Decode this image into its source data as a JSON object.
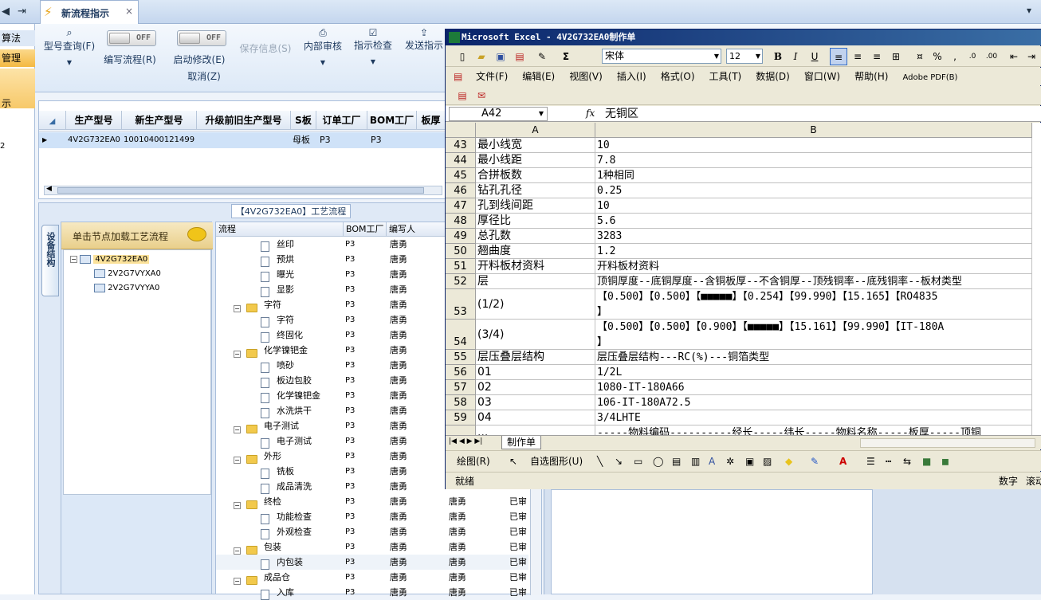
{
  "top": {
    "tab_label": "新流程指示"
  },
  "left_strip": {
    "items": [
      "算法",
      "管理",
      "示",
      "2"
    ]
  },
  "toolbar": {
    "model_query": "型号查询(F)",
    "write_flow": "编写流程(R)",
    "start_modify": "启动修改(E)",
    "cancel": "取消(Z)",
    "save_info": "保存信息(S)",
    "internal_review": "内部审核",
    "instruction_check": "指示检查",
    "send_instruction": "发送指示",
    "toggle_off": "OFF"
  },
  "grid": {
    "columns": [
      "生产型号",
      "新生产型号",
      "升级前旧生产型号",
      "S板",
      "订单工厂",
      "BOM工厂",
      "板厚"
    ],
    "rows": [
      [
        "4V2G732EA0",
        "10010400121499",
        "",
        "母板",
        "P3",
        "P3",
        ""
      ]
    ]
  },
  "process": {
    "title": "【4V2G732EA0】工艺流程",
    "side_tab": "设备结构",
    "tree_hint": "单击节点加载工艺流程",
    "tree_nodes": [
      "4V2G732EA0",
      "2V2G7VYXA0",
      "2V2G7VYYA0"
    ],
    "columns": [
      "流程",
      "BOM工厂",
      "编写人"
    ],
    "rows": [
      {
        "name": "丝印",
        "level": 2,
        "bom": "P3",
        "writer": "唐勇",
        "extra": "",
        "status": ""
      },
      {
        "name": "预烘",
        "level": 2,
        "bom": "P3",
        "writer": "唐勇",
        "extra": "",
        "status": ""
      },
      {
        "name": "曝光",
        "level": 2,
        "bom": "P3",
        "writer": "唐勇",
        "extra": "",
        "status": ""
      },
      {
        "name": "显影",
        "level": 2,
        "bom": "P3",
        "writer": "唐勇",
        "extra": "",
        "status": ""
      },
      {
        "name": "字符",
        "level": 1,
        "bom": "P3",
        "writer": "唐勇",
        "extra": "",
        "status": ""
      },
      {
        "name": "字符",
        "level": 2,
        "bom": "P3",
        "writer": "唐勇",
        "extra": "",
        "status": ""
      },
      {
        "name": "终固化",
        "level": 2,
        "bom": "P3",
        "writer": "唐勇",
        "extra": "",
        "status": ""
      },
      {
        "name": "化学镍钯金",
        "level": 1,
        "bom": "P3",
        "writer": "唐勇",
        "extra": "",
        "status": ""
      },
      {
        "name": "喷砂",
        "level": 2,
        "bom": "P3",
        "writer": "唐勇",
        "extra": "",
        "status": ""
      },
      {
        "name": "板边包胶",
        "level": 2,
        "bom": "P3",
        "writer": "唐勇",
        "extra": "",
        "status": ""
      },
      {
        "name": "化学镍钯金",
        "level": 2,
        "bom": "P3",
        "writer": "唐勇",
        "extra": "",
        "status": ""
      },
      {
        "name": "水洗烘干",
        "level": 2,
        "bom": "P3",
        "writer": "唐勇",
        "extra": "",
        "status": ""
      },
      {
        "name": "电子测试",
        "level": 1,
        "bom": "P3",
        "writer": "唐勇",
        "extra": "",
        "status": ""
      },
      {
        "name": "电子测试",
        "level": 2,
        "bom": "P3",
        "writer": "唐勇",
        "extra": "",
        "status": ""
      },
      {
        "name": "外形",
        "level": 1,
        "bom": "P3",
        "writer": "唐勇",
        "extra": "",
        "status": ""
      },
      {
        "name": "铣板",
        "level": 2,
        "bom": "P3",
        "writer": "唐勇",
        "extra": "",
        "status": ""
      },
      {
        "name": "成品清洗",
        "level": 2,
        "bom": "P3",
        "writer": "唐勇",
        "extra": "",
        "status": ""
      },
      {
        "name": "终检",
        "level": 1,
        "bom": "P3",
        "writer": "唐勇",
        "extra": "唐勇",
        "status": "已审"
      },
      {
        "name": "功能检查",
        "level": 2,
        "bom": "P3",
        "writer": "唐勇",
        "extra": "唐勇",
        "status": "已审"
      },
      {
        "name": "外观检查",
        "level": 2,
        "bom": "P3",
        "writer": "唐勇",
        "extra": "唐勇",
        "status": "已审"
      },
      {
        "name": "包装",
        "level": 1,
        "bom": "P3",
        "writer": "唐勇",
        "extra": "唐勇",
        "status": "已审"
      },
      {
        "name": "内包装",
        "level": 2,
        "bom": "P3",
        "writer": "唐勇",
        "extra": "唐勇",
        "status": "已审"
      },
      {
        "name": "成品仓",
        "level": 1,
        "bom": "P3",
        "writer": "唐勇",
        "extra": "唐勇",
        "status": "已审"
      },
      {
        "name": "入库",
        "level": 2,
        "bom": "P3",
        "writer": "唐勇",
        "extra": "唐勇",
        "status": "已审"
      }
    ]
  },
  "excel": {
    "title": "Microsoft Excel - 4V2G732EA0制作单",
    "font": "宋体",
    "font_size": "12",
    "menu": [
      "文件(F)",
      "编辑(E)",
      "视图(V)",
      "插入(I)",
      "格式(O)",
      "工具(T)",
      "数据(D)",
      "窗口(W)",
      "帮助(H)",
      "Adobe PDF(B)"
    ],
    "name_box": "A42",
    "formula": "无铜区",
    "col_a": "A",
    "col_b": "B",
    "rows": [
      {
        "n": "43",
        "a": "最小线宽",
        "b": "10"
      },
      {
        "n": "44",
        "a": "最小线距",
        "b": "7.8"
      },
      {
        "n": "45",
        "a": "合拼板数",
        "b": "1种相同"
      },
      {
        "n": "46",
        "a": "钻孔孔径",
        "b": "0.25"
      },
      {
        "n": "47",
        "a": "孔到线间距",
        "b": "10"
      },
      {
        "n": "48",
        "a": "厚径比",
        "b": "5.6"
      },
      {
        "n": "49",
        "a": "总孔数",
        "b": "3283"
      },
      {
        "n": "50",
        "a": "翘曲度",
        "b": "1.2"
      },
      {
        "n": "51",
        "a": "开料板材资料",
        "b": "开料板材资料"
      },
      {
        "n": "52",
        "a": "层",
        "b": "顶铜厚度--底铜厚度--含铜板厚--不含铜厚--顶残铜率--底残铜率--板材类型"
      },
      {
        "n": "53",
        "a": "(1/2)",
        "b": "【0.500】【0.500】【■■■■■】【0.254】【99.990】【15.165】【RO4835",
        "b2": "】"
      },
      {
        "n": "54",
        "a": "(3/4)",
        "b": "【0.500】【0.500】【0.900】【■■■■■】【15.161】【99.990】【IT-180A",
        "b2": "】"
      },
      {
        "n": "55",
        "a": "层压叠层结构",
        "b": "层压叠层结构---RC(%)---铜箔类型"
      },
      {
        "n": "56",
        "a": "01",
        "b": "1/2L"
      },
      {
        "n": "57",
        "a": "02",
        "b": "1080-IT-180A66"
      },
      {
        "n": "58",
        "a": "03",
        "b": "106-IT-180A72.5"
      },
      {
        "n": "59",
        "a": "04",
        "b": "3/4LHTE"
      },
      {
        "n": "",
        "a": "...",
        "b": "-----物料编码----------经长-----纬长-----物料名称-----板厚-----顶铜"
      }
    ],
    "sheet_tab": "制作单",
    "draw_label": "绘图(R)",
    "autoshape_label": "自选图形(U)",
    "status_ready": "就绪",
    "status_num": "数字",
    "status_scroll": "滚动"
  }
}
